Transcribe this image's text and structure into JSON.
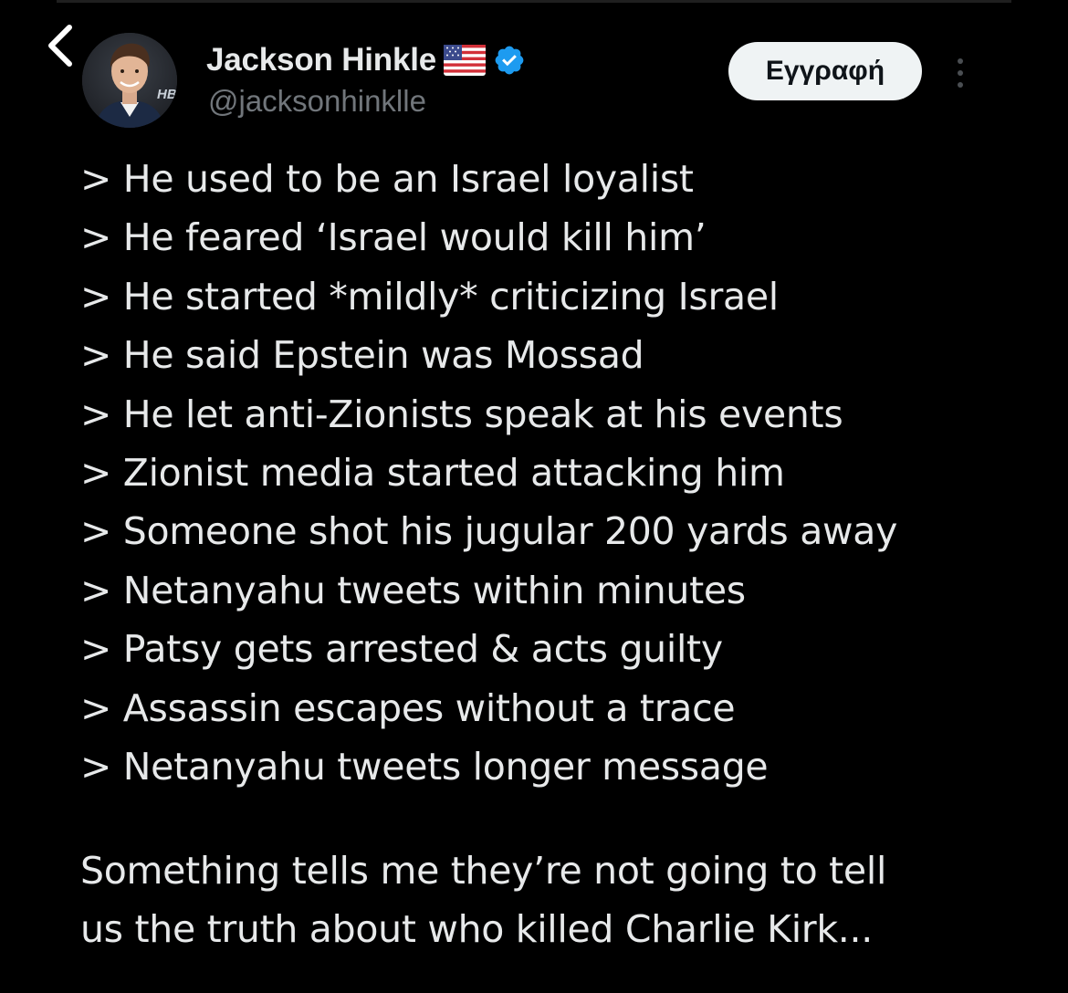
{
  "header": {
    "display_name": "Jackson Hinkle",
    "handle": "@jacksonhinklle",
    "subscribe_label": "Εγγραφή",
    "flag_icon": "us-flag-icon",
    "verified_icon": "verified-badge-icon",
    "back_icon": "chevron-left-icon",
    "more_icon": "more-vertical-icon",
    "avatar_badge_text": "HB"
  },
  "tweet": {
    "lines": [
      "> He used to be an Israel loyalist",
      "> He feared ‘Israel would kill him’",
      "> He started *mildly* criticizing Israel",
      "> He said Epstein was Mossad",
      "> He let anti-Zionists speak at his events",
      "> Zionist media started attacking him",
      "> Someone shot his jugular 200 yards away",
      "> Netanyahu tweets within minutes",
      "> Patsy gets arrested & acts guilty",
      "> Assassin escapes without a trace",
      "> Netanyahu tweets longer message"
    ],
    "closing_lines": [
      "Something tells me they’re not going to tell",
      "us the truth about who killed Charlie Kirk..."
    ]
  },
  "colors": {
    "background": "#000000",
    "text_primary": "#e7e9ea",
    "text_secondary": "#71767b",
    "verified_blue": "#1d9bf0",
    "button_bg": "#eff3f4",
    "button_text": "#0f1419"
  }
}
